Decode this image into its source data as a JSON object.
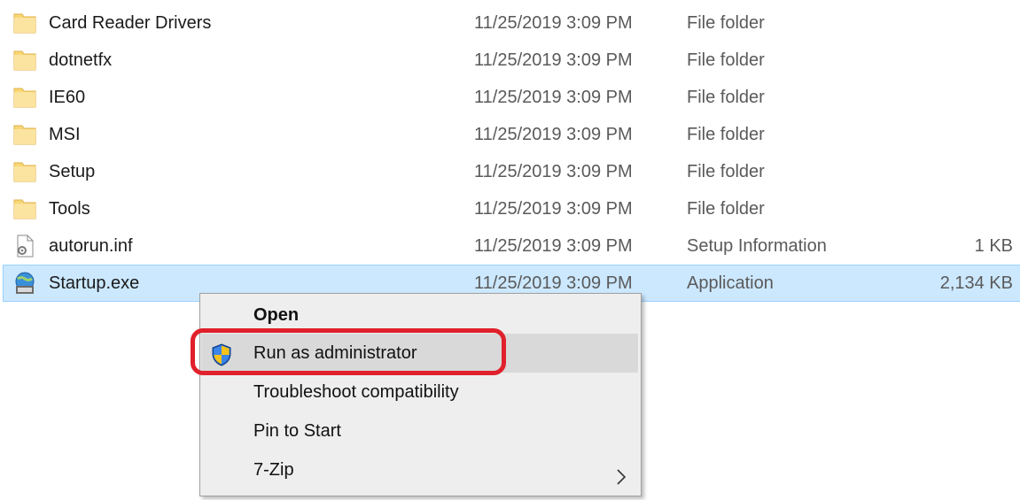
{
  "files": [
    {
      "name": "Card Reader Drivers",
      "date": "11/25/2019 3:09 PM",
      "type": "File folder",
      "size": "",
      "icon": "folder-icon",
      "selected": false
    },
    {
      "name": "dotnetfx",
      "date": "11/25/2019 3:09 PM",
      "type": "File folder",
      "size": "",
      "icon": "folder-icon",
      "selected": false
    },
    {
      "name": "IE60",
      "date": "11/25/2019 3:09 PM",
      "type": "File folder",
      "size": "",
      "icon": "folder-icon",
      "selected": false
    },
    {
      "name": "MSI",
      "date": "11/25/2019 3:09 PM",
      "type": "File folder",
      "size": "",
      "icon": "folder-icon",
      "selected": false
    },
    {
      "name": "Setup",
      "date": "11/25/2019 3:09 PM",
      "type": "File folder",
      "size": "",
      "icon": "folder-icon",
      "selected": false
    },
    {
      "name": "Tools",
      "date": "11/25/2019 3:09 PM",
      "type": "File folder",
      "size": "",
      "icon": "folder-icon",
      "selected": false
    },
    {
      "name": "autorun.inf",
      "date": "11/25/2019 3:09 PM",
      "type": "Setup Information",
      "size": "1 KB",
      "icon": "settings-file-icon",
      "selected": false
    },
    {
      "name": "Startup.exe",
      "date": "11/25/2019 3:09 PM",
      "type": "Application",
      "size": "2,134 KB",
      "icon": "application-globe-icon",
      "selected": true
    }
  ],
  "context_menu": {
    "items": [
      {
        "label": "Open",
        "icon": "",
        "default": true,
        "hover": false,
        "submenu": false
      },
      {
        "label": "Run as administrator",
        "icon": "uac-shield-icon",
        "default": false,
        "hover": true,
        "submenu": false
      },
      {
        "label": "Troubleshoot compatibility",
        "icon": "",
        "default": false,
        "hover": false,
        "submenu": false
      },
      {
        "label": "Pin to Start",
        "icon": "",
        "default": false,
        "hover": false,
        "submenu": false
      },
      {
        "label": "7-Zip",
        "icon": "",
        "default": false,
        "hover": false,
        "submenu": true
      }
    ]
  },
  "colors": {
    "selection_bg": "#cce8ff",
    "selection_border": "#99d1ff",
    "menu_bg": "#eeeeee",
    "menu_hover": "#d9d9d9",
    "annotation_ring": "#e0202a",
    "folder_yellow": "#f8d775"
  }
}
